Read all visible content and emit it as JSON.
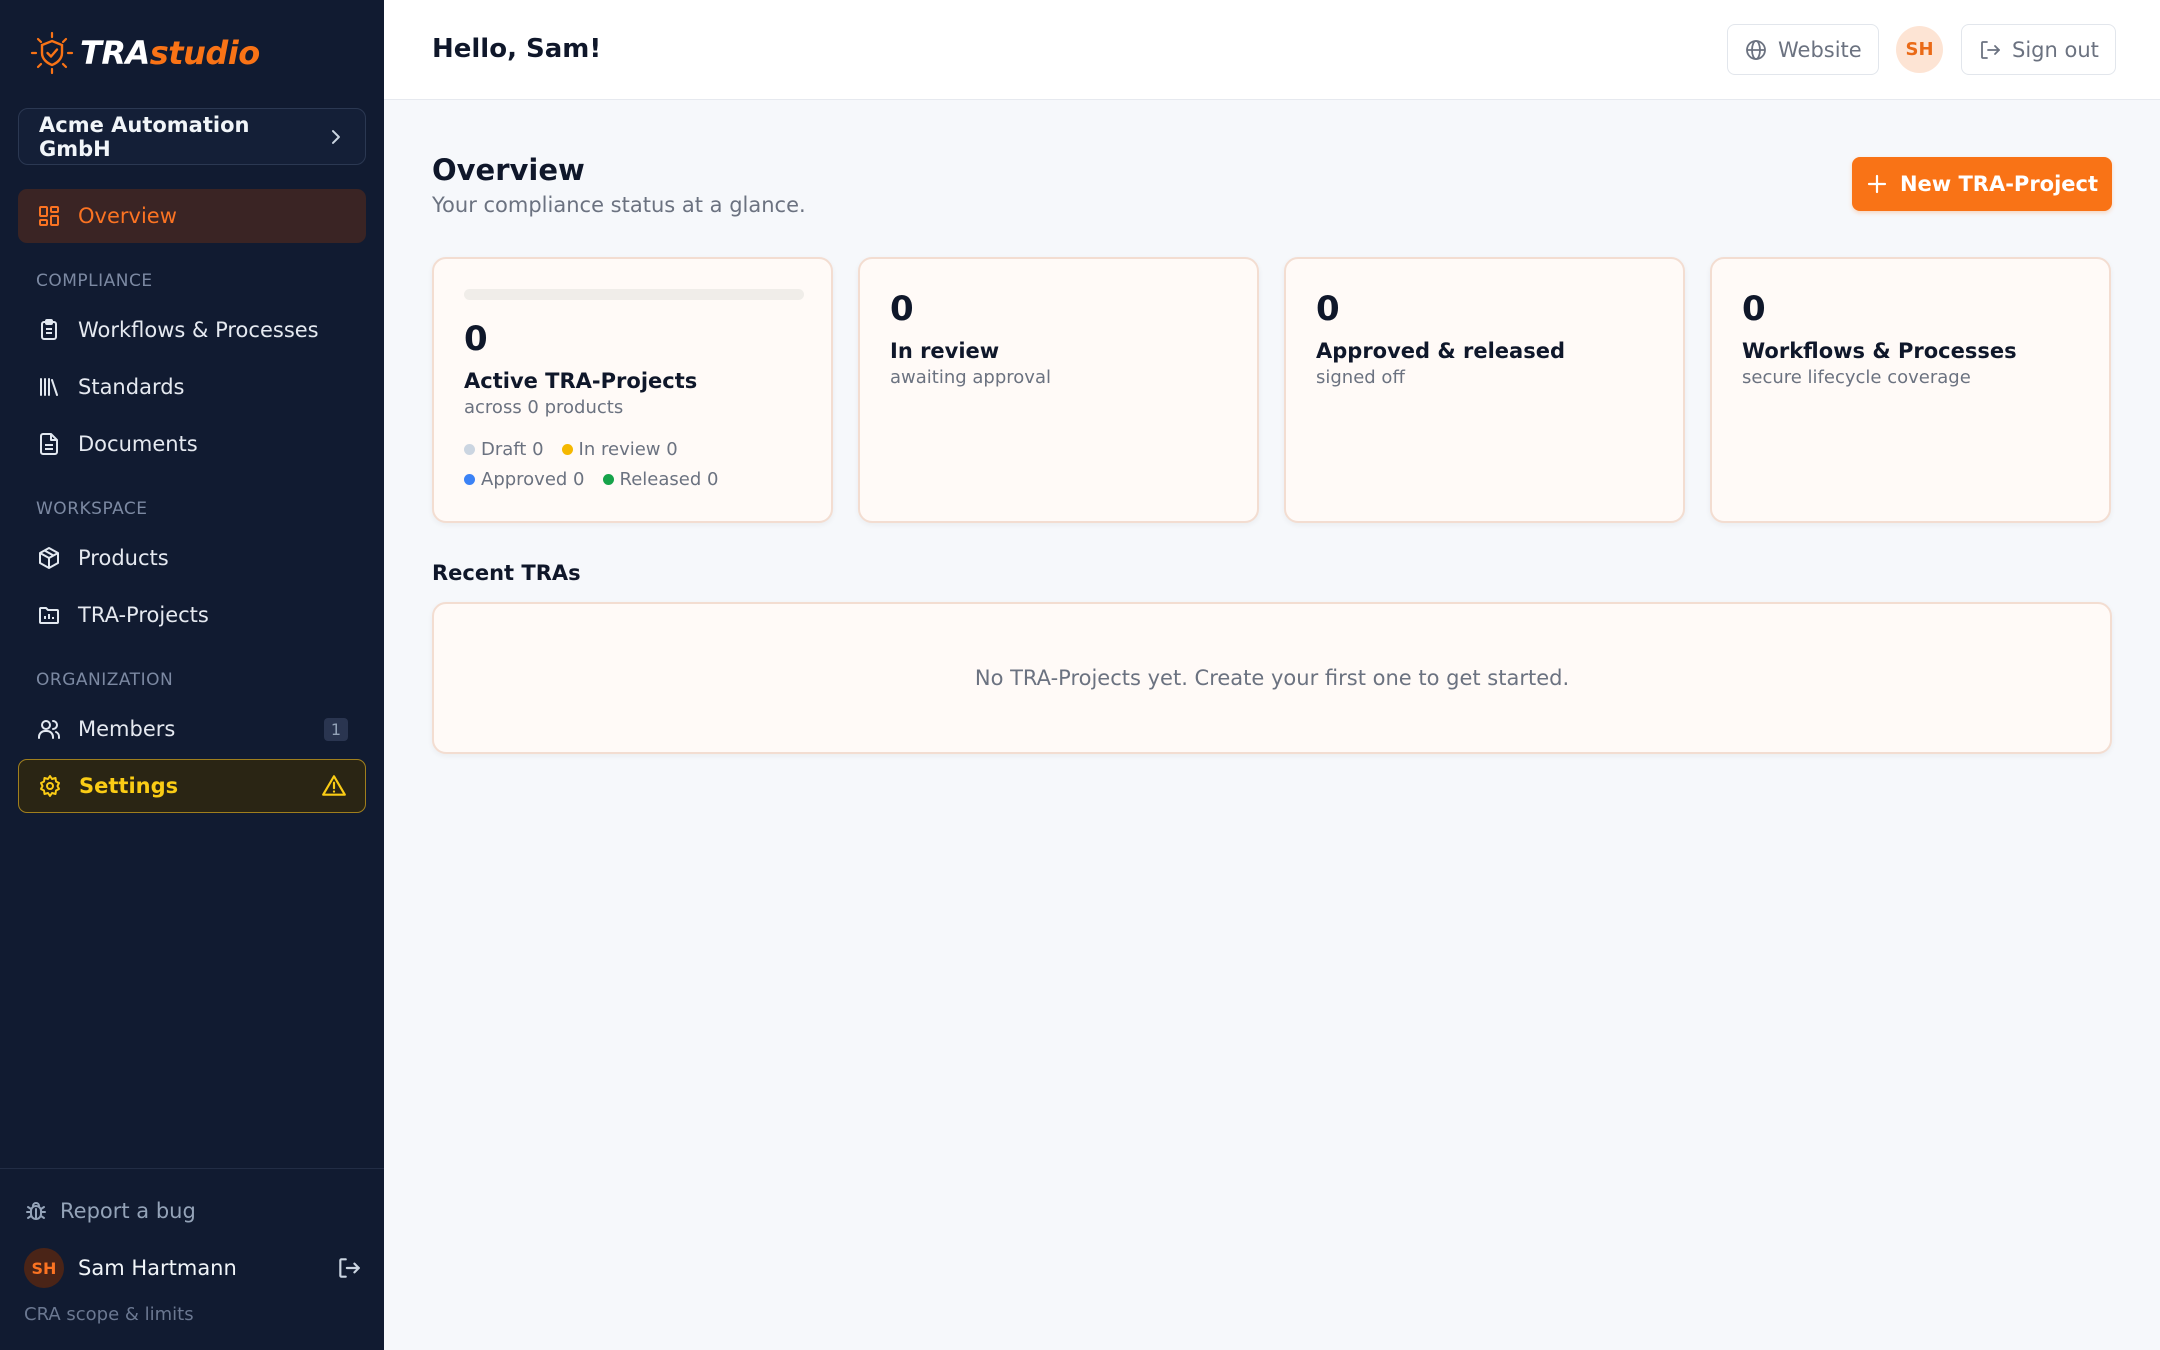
{
  "brand": {
    "logo_part1": "TRA",
    "logo_part2": "studio",
    "accent_color": "#f97316"
  },
  "sidebar": {
    "org_name": "Acme Automation GmbH",
    "overview": "Overview",
    "sections": {
      "compliance": "COMPLIANCE",
      "workspace": "WORKSPACE",
      "organization": "ORGANIZATION"
    },
    "items": {
      "workflows": "Workflows & Processes",
      "standards": "Standards",
      "documents": "Documents",
      "products": "Products",
      "tra_projects": "TRA-Projects",
      "members": "Members",
      "members_count": "1",
      "settings": "Settings"
    },
    "footer": {
      "report_bug": "Report a bug",
      "user_initials": "SH",
      "user_name": "Sam Hartmann",
      "cra_link": "CRA scope & limits"
    }
  },
  "topbar": {
    "greeting": "Hello, Sam!",
    "website_label": "Website",
    "avatar_initials": "SH",
    "signout_label": "Sign out"
  },
  "main": {
    "title": "Overview",
    "subtitle": "Your compliance status at a glance.",
    "new_button": "New TRA-Project",
    "cards": [
      {
        "value": "0",
        "label": "Active TRA-Projects",
        "sub": "across 0 products"
      },
      {
        "value": "0",
        "label": "In review",
        "sub": "awaiting approval"
      },
      {
        "value": "0",
        "label": "Approved & released",
        "sub": "signed off"
      },
      {
        "value": "0",
        "label": "Workflows & Processes",
        "sub": "secure lifecycle coverage"
      }
    ],
    "status_legend": {
      "draft": "Draft 0",
      "in_review": "In review 0",
      "approved": "Approved 0",
      "released": "Released 0"
    },
    "status_colors": {
      "draft": "#cbd5e1",
      "in_review": "#f5b800",
      "approved": "#3b82f6",
      "released": "#16a34a"
    },
    "recent_title": "Recent TRAs",
    "empty_message": "No TRA-Projects yet. Create your first one to get started."
  }
}
